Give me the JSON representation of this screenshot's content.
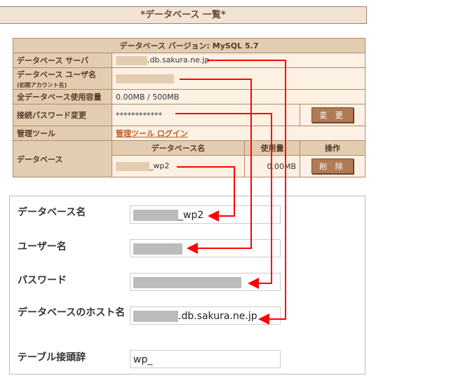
{
  "title": "*データベース 一覧*",
  "table": {
    "version": "データベース バージョン: MySQL 5.7",
    "server_label": "データベース サーバ",
    "server_value": ".db.sakura.ne.jp",
    "user_label": "データベース ユーザ名",
    "user_sub": "(初期アカウント名)",
    "usage_label": "全データベース使用容量",
    "usage_value": "0.00MB / 500MB",
    "password_label": "接続パスワード変更",
    "password_value": "************",
    "change_button": "変 更",
    "tool_label": "管理ツール",
    "tool_link": "管理ツール ログイン",
    "db_label": "データベース",
    "col_name": "データベース名",
    "col_usage": "使用量",
    "col_action": "操作",
    "db_name": "_wp2",
    "db_usage": "0.00MB",
    "delete_button": "削 除"
  },
  "form": {
    "db_name_label": "データベース名",
    "db_name_value": "_wp2",
    "user_label": "ユーザー名",
    "password_label": "パスワード",
    "host_label": "データベースのホスト名",
    "host_value": ".db.sakura.ne.jp",
    "prefix_label": "テーブル接頭辞",
    "prefix_value": "wp_"
  },
  "colors": {
    "arrow": "#ff0000",
    "header": "#e3cdb0",
    "cell": "#fdf1e4"
  }
}
